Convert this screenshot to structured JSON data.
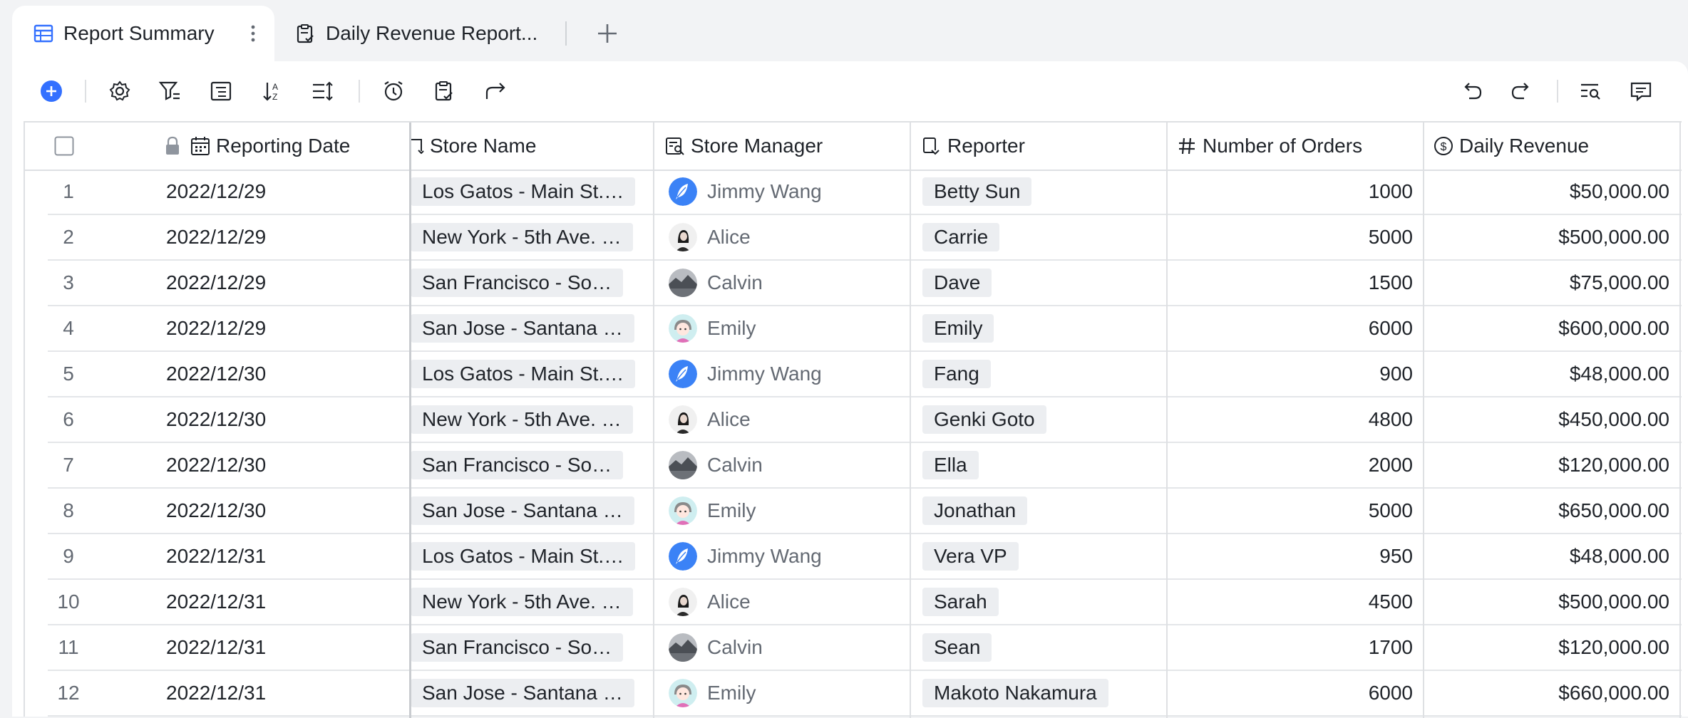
{
  "tabs": [
    {
      "label": "Report Summary",
      "icon": "table-icon",
      "active": true
    },
    {
      "label": "Daily Revenue Report...",
      "icon": "form-icon",
      "active": false
    }
  ],
  "toolbar": {
    "left_icons": [
      "add-record-icon",
      "settings-icon",
      "filter-icon",
      "group-icon",
      "sort-icon",
      "row-height-icon",
      "automation-icon",
      "form-icon",
      "share-icon"
    ],
    "right_icons": [
      "undo-icon",
      "redo-icon",
      "search-icon",
      "comment-icon"
    ],
    "accent": "#3370ff"
  },
  "columns": {
    "reporting_date": "Reporting Date",
    "store_name": "Store Name",
    "store_manager": "Store Manager",
    "reporter": "Reporter",
    "orders": "Number of Orders",
    "revenue": "Daily Revenue"
  },
  "rows": [
    {
      "n": "1",
      "date": "2022/12/29",
      "store": "Los Gatos - Main St.…",
      "manager": "Jimmy Wang",
      "avatar": "feather",
      "reporter": "Betty Sun",
      "orders": "1000",
      "revenue": "$50,000.00"
    },
    {
      "n": "2",
      "date": "2022/12/29",
      "store": "New York - 5th Ave. …",
      "manager": "Alice",
      "avatar": "woman",
      "reporter": "Carrie",
      "orders": "5000",
      "revenue": "$500,000.00"
    },
    {
      "n": "3",
      "date": "2022/12/29",
      "store": "San Francisco - So…",
      "manager": "Calvin",
      "avatar": "landscape",
      "reporter": "Dave",
      "orders": "1500",
      "revenue": "$75,000.00"
    },
    {
      "n": "4",
      "date": "2022/12/29",
      "store": "San Jose - Santana …",
      "manager": "Emily",
      "avatar": "cartoon",
      "reporter": "Emily",
      "orders": "6000",
      "revenue": "$600,000.00"
    },
    {
      "n": "5",
      "date": "2022/12/30",
      "store": "Los Gatos - Main St.…",
      "manager": "Jimmy Wang",
      "avatar": "feather",
      "reporter": "Fang",
      "orders": "900",
      "revenue": "$48,000.00"
    },
    {
      "n": "6",
      "date": "2022/12/30",
      "store": "New York - 5th Ave. …",
      "manager": "Alice",
      "avatar": "woman",
      "reporter": "Genki Goto",
      "orders": "4800",
      "revenue": "$450,000.00"
    },
    {
      "n": "7",
      "date": "2022/12/30",
      "store": "San Francisco - So…",
      "manager": "Calvin",
      "avatar": "landscape",
      "reporter": "Ella",
      "orders": "2000",
      "revenue": "$120,000.00"
    },
    {
      "n": "8",
      "date": "2022/12/30",
      "store": "San Jose - Santana …",
      "manager": "Emily",
      "avatar": "cartoon",
      "reporter": "Jonathan",
      "orders": "5000",
      "revenue": "$650,000.00"
    },
    {
      "n": "9",
      "date": "2022/12/31",
      "store": "Los Gatos - Main St.…",
      "manager": "Jimmy Wang",
      "avatar": "feather",
      "reporter": "Vera VP",
      "orders": "950",
      "revenue": "$48,000.00"
    },
    {
      "n": "10",
      "date": "2022/12/31",
      "store": "New York - 5th Ave. …",
      "manager": "Alice",
      "avatar": "woman",
      "reporter": "Sarah",
      "orders": "4500",
      "revenue": "$500,000.00"
    },
    {
      "n": "11",
      "date": "2022/12/31",
      "store": "San Francisco - So…",
      "manager": "Calvin",
      "avatar": "landscape",
      "reporter": "Sean",
      "orders": "1700",
      "revenue": "$120,000.00"
    },
    {
      "n": "12",
      "date": "2022/12/31",
      "store": "San Jose - Santana …",
      "manager": "Emily",
      "avatar": "cartoon",
      "reporter": "Makoto Nakamura",
      "orders": "6000",
      "revenue": "$660,000.00"
    }
  ]
}
